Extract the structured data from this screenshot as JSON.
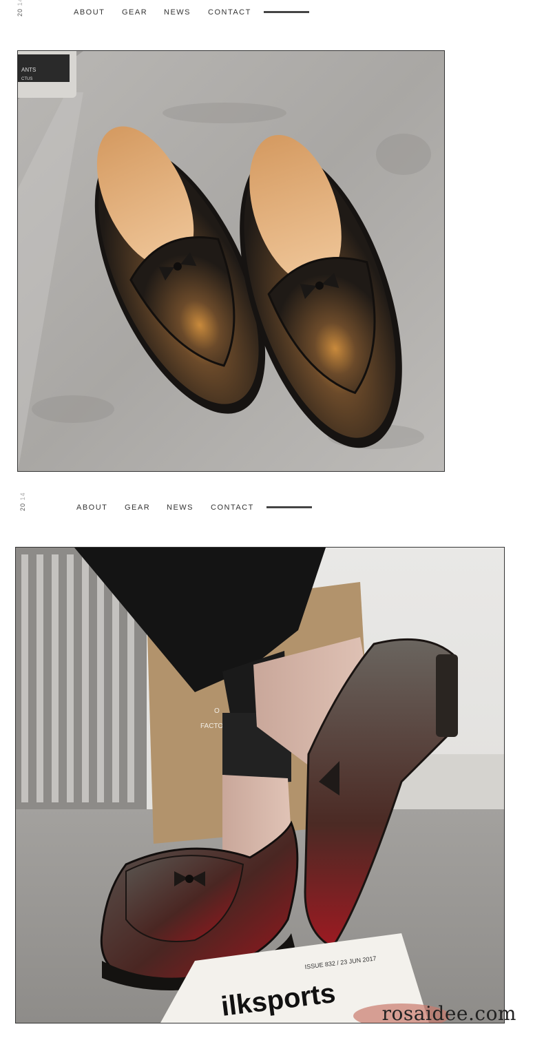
{
  "nav1": {
    "year_top": "20",
    "year_bottom": "14",
    "links": [
      "ABOUT",
      "GEAR",
      "NEWS",
      "CONTACT"
    ]
  },
  "nav2": {
    "year_top": "20",
    "year_bottom": "14",
    "links": [
      "ABOUT",
      "GEAR",
      "NEWS",
      "CONTACT"
    ]
  },
  "photo1": {
    "subject": "product-photo-loafers-top-view",
    "can_label_line1": "ANTS",
    "can_label_line2": "CTUS"
  },
  "photo2": {
    "subject": "product-photo-loafers-worn",
    "bag_text_line1": "O",
    "bag_text_line2": "FACTO",
    "magazine_header": "ISSUE 832 / 23 JUN 2017",
    "magazine_title": "ilksports"
  },
  "watermark": "rosaidee.com",
  "colors": {
    "nav_text": "#333333",
    "nav_bar": "#444444",
    "frame": "#333333"
  }
}
